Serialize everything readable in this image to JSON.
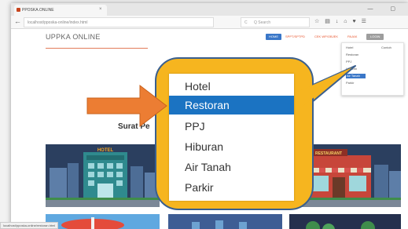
{
  "browser": {
    "tab_title": "PPOSKA.ONLINE",
    "tab_close": "×",
    "window_controls": "— ▢",
    "url": "localhost/pposka-online/index.html",
    "reload_icon": "C",
    "search_placeholder": "Q Search",
    "toolbar_icons": [
      "☆",
      "▤",
      "↓",
      "⌂",
      "♥",
      "☰"
    ]
  },
  "site": {
    "title": "UPPKA ONLINE",
    "nav": {
      "home": "HOME",
      "link_2": "SPPT/SPTPD",
      "link_3": "CEK WP/OBJEK",
      "link_4": "PAJAK",
      "login": "LOGIN"
    },
    "dropdown": {
      "header": "Contoh",
      "items": [
        "Hotel",
        "Restoran",
        "PPJ",
        "Hiburan",
        "Air Tanah",
        "Parkir"
      ],
      "active_index": 4
    },
    "section_heading": "Surat Pe",
    "cards": {
      "hotel_sign": "HOTEL",
      "restaurant_sign": "RESTAURANT"
    }
  },
  "callout": {
    "menu_items": [
      "Hotel",
      "Restoran",
      "PPJ",
      "Hiburan",
      "Air Tanah",
      "Parkir"
    ],
    "active_item": "Restoran",
    "accent_color": "#f6b51f",
    "arrow_color": "#ec7d33",
    "highlight_color": "#1b73c2"
  },
  "status_bar": "localhost/pposka-online/restoran.html"
}
